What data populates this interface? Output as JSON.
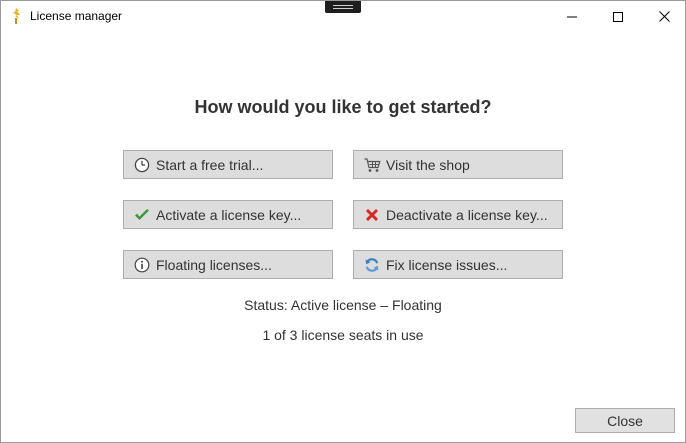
{
  "window": {
    "title": "License manager"
  },
  "main": {
    "heading": "How would you like to get started?",
    "buttons": [
      {
        "label": "Start a free trial...",
        "icon": "clock-icon"
      },
      {
        "label": "Visit the shop",
        "icon": "cart-icon"
      },
      {
        "label": "Activate a license key...",
        "icon": "checkmark-icon"
      },
      {
        "label": "Deactivate a license key...",
        "icon": "cross-icon"
      },
      {
        "label": "Floating licenses...",
        "icon": "info-icon"
      },
      {
        "label": "Fix license issues...",
        "icon": "refresh-icon"
      }
    ],
    "status_line": "Status: Active license – Floating",
    "seats_line": "1 of 3 license seats in use"
  },
  "footer": {
    "close_label": "Close"
  },
  "colors": {
    "button_bg": "#dddddd",
    "button_border": "#adadad",
    "check_green": "#3a9a3a",
    "cross_red": "#d9281e",
    "refresh_blue": "#3a7fc1"
  }
}
